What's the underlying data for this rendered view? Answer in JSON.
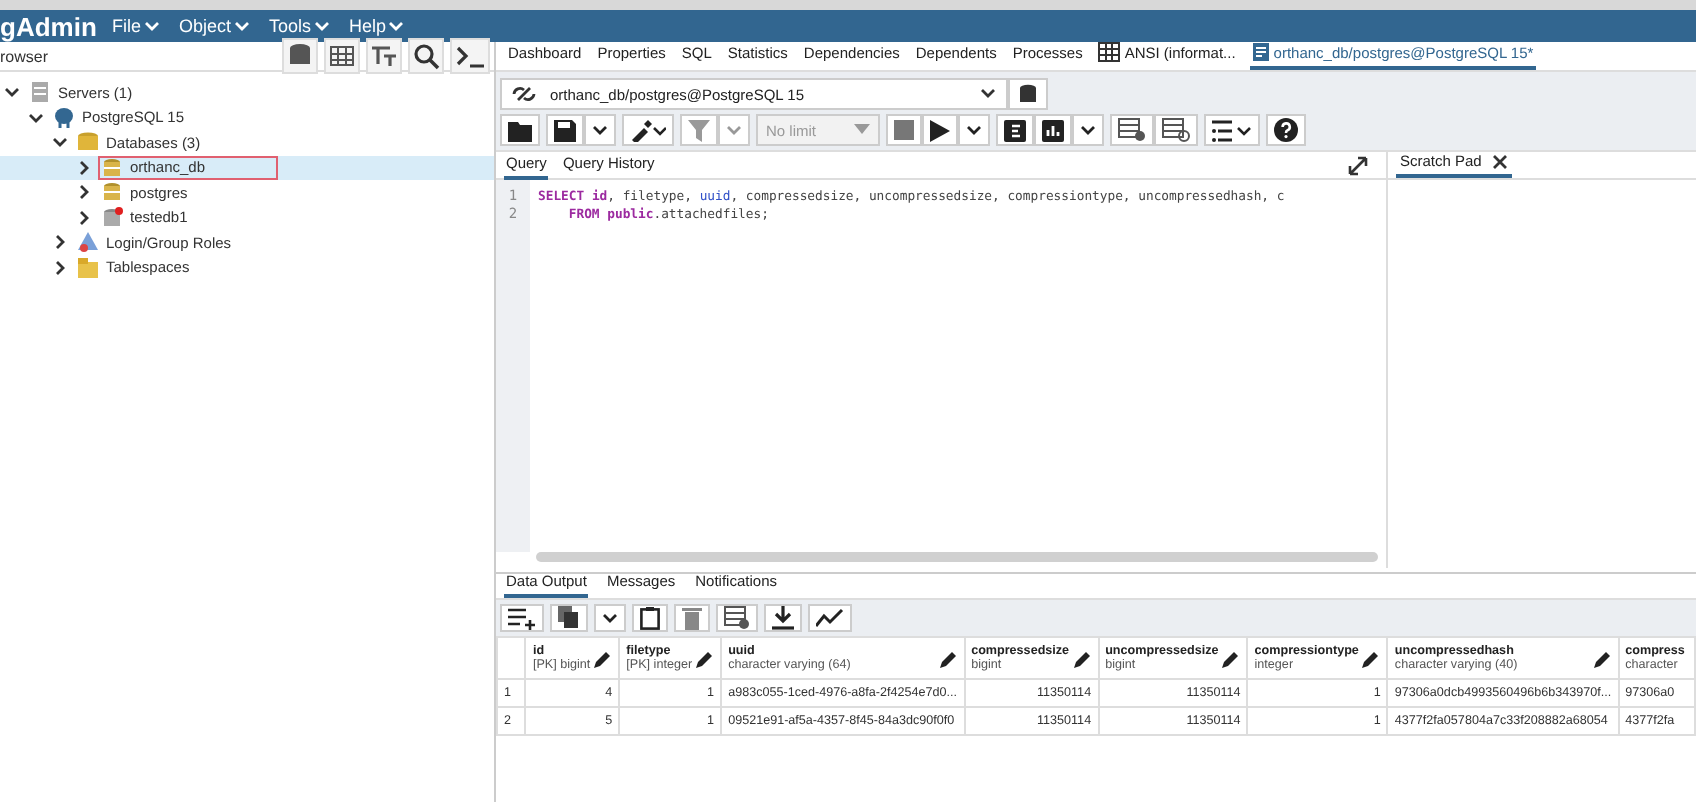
{
  "app": {
    "logo": "gAdmin",
    "menu": [
      {
        "label": "File"
      },
      {
        "label": "Object"
      },
      {
        "label": "Tools"
      },
      {
        "label": "Help"
      }
    ]
  },
  "browser": {
    "title": "rowser",
    "tree": [
      {
        "label": "Servers (1)",
        "kind": "servers",
        "expanded": true,
        "selected": false,
        "children": [
          {
            "label": "PostgreSQL 15",
            "kind": "server",
            "expanded": true,
            "selected": false,
            "children": [
              {
                "label": "Databases (3)",
                "kind": "databases",
                "expanded": true,
                "selected": false,
                "children": [
                  {
                    "label": "orthanc_db",
                    "kind": "database",
                    "expanded": false,
                    "selected": true
                  },
                  {
                    "label": "postgres",
                    "kind": "database",
                    "expanded": false,
                    "selected": false
                  },
                  {
                    "label": "testedb1",
                    "kind": "disconnected",
                    "expanded": false,
                    "selected": false
                  }
                ]
              },
              {
                "label": "Login/Group Roles",
                "kind": "roles",
                "expanded": false,
                "selected": false
              },
              {
                "label": "Tablespaces",
                "kind": "tablespaces",
                "expanded": false,
                "selected": false
              }
            ]
          }
        ]
      }
    ]
  },
  "tabs": [
    {
      "label": "Dashboard",
      "kind": "plain",
      "selected": false
    },
    {
      "label": "Properties",
      "kind": "plain",
      "selected": false
    },
    {
      "label": "SQL",
      "kind": "plain",
      "selected": false
    },
    {
      "label": "Statistics",
      "kind": "plain",
      "selected": false
    },
    {
      "label": "Dependencies",
      "kind": "plain",
      "selected": false
    },
    {
      "label": "Dependents",
      "kind": "plain",
      "selected": false
    },
    {
      "label": "Processes",
      "kind": "plain",
      "selected": false
    },
    {
      "label": "ANSI (informat...",
      "kind": "table",
      "selected": false
    },
    {
      "label": "orthanc_db/postgres@PostgreSQL 15*",
      "kind": "query",
      "selected": true
    }
  ],
  "connection": {
    "value": "orthanc_db/postgres@PostgreSQL 15"
  },
  "limit": {
    "value": "No limit"
  },
  "query_tabs": [
    {
      "label": "Query",
      "selected": true
    },
    {
      "label": "Query History",
      "selected": false
    }
  ],
  "scratch_pad": {
    "title": "Scratch Pad"
  },
  "editor": {
    "lines": [
      {
        "number": "1",
        "tokens": [
          {
            "text": "SELECT",
            "kind": "keyword"
          },
          {
            "text": " id",
            "kind": "keyword"
          },
          {
            "text": ", filetype, ",
            "kind": "plain"
          },
          {
            "text": "uuid",
            "kind": "type"
          },
          {
            "text": ", compressedsize, uncompressedsize, compressiontype, uncompressedhash, c",
            "kind": "plain"
          }
        ]
      },
      {
        "number": "2",
        "tokens": [
          {
            "text": "    FROM public",
            "kind": "keyword"
          },
          {
            "text": ".attachedfiles;",
            "kind": "plain"
          }
        ]
      }
    ]
  },
  "result_tabs": [
    {
      "label": "Data Output",
      "selected": true
    },
    {
      "label": "Messages",
      "selected": false
    },
    {
      "label": "Notifications",
      "selected": false
    }
  ],
  "table": {
    "columns": [
      {
        "name": "id",
        "type": "[PK] bigint"
      },
      {
        "name": "filetype",
        "type": "[PK] integer"
      },
      {
        "name": "uuid",
        "type": "character varying (64)"
      },
      {
        "name": "compressedsize",
        "type": "bigint"
      },
      {
        "name": "uncompressedsize",
        "type": "bigint"
      },
      {
        "name": "compressiontype",
        "type": "integer"
      },
      {
        "name": "uncompressedhash",
        "type": "character varying (40)"
      },
      {
        "name": "compress",
        "type": "character"
      }
    ],
    "rows": [
      {
        "number": "1",
        "cells": [
          "4",
          "1",
          "a983c055-1ced-4976-a8fa-2f4254e7d0...",
          "11350114",
          "11350114",
          "1",
          "97306a0dcb4993560496b6b343970f...",
          "97306a0"
        ]
      },
      {
        "number": "2",
        "cells": [
          "5",
          "1",
          "09521e91-af5a-4357-8f45-84a3dc90f0f0",
          "11350114",
          "11350114",
          "1",
          "4377f2fa057804a7c33f208882a68054",
          "4377f2fa"
        ]
      }
    ]
  }
}
